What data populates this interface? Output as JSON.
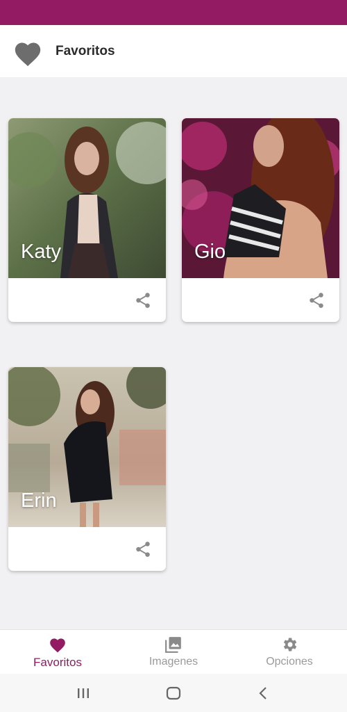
{
  "app": {
    "title": "Favoritos"
  },
  "colors": {
    "brand": "#931b64",
    "background": "#f1f0f2",
    "inactive": "#9a9a9a"
  },
  "cards": [
    {
      "name": "Katy",
      "icon": "share-icon"
    },
    {
      "name": "Gio",
      "icon": "share-icon"
    },
    {
      "name": "Erin",
      "icon": "share-icon"
    }
  ],
  "bottom_nav": [
    {
      "label": "Favoritos",
      "icon": "heart-icon",
      "active": true
    },
    {
      "label": "Imagenes",
      "icon": "images-icon",
      "active": false
    },
    {
      "label": "Opciones",
      "icon": "gear-icon",
      "active": false
    }
  ],
  "system_nav": [
    "recents-icon",
    "home-icon",
    "back-icon"
  ]
}
